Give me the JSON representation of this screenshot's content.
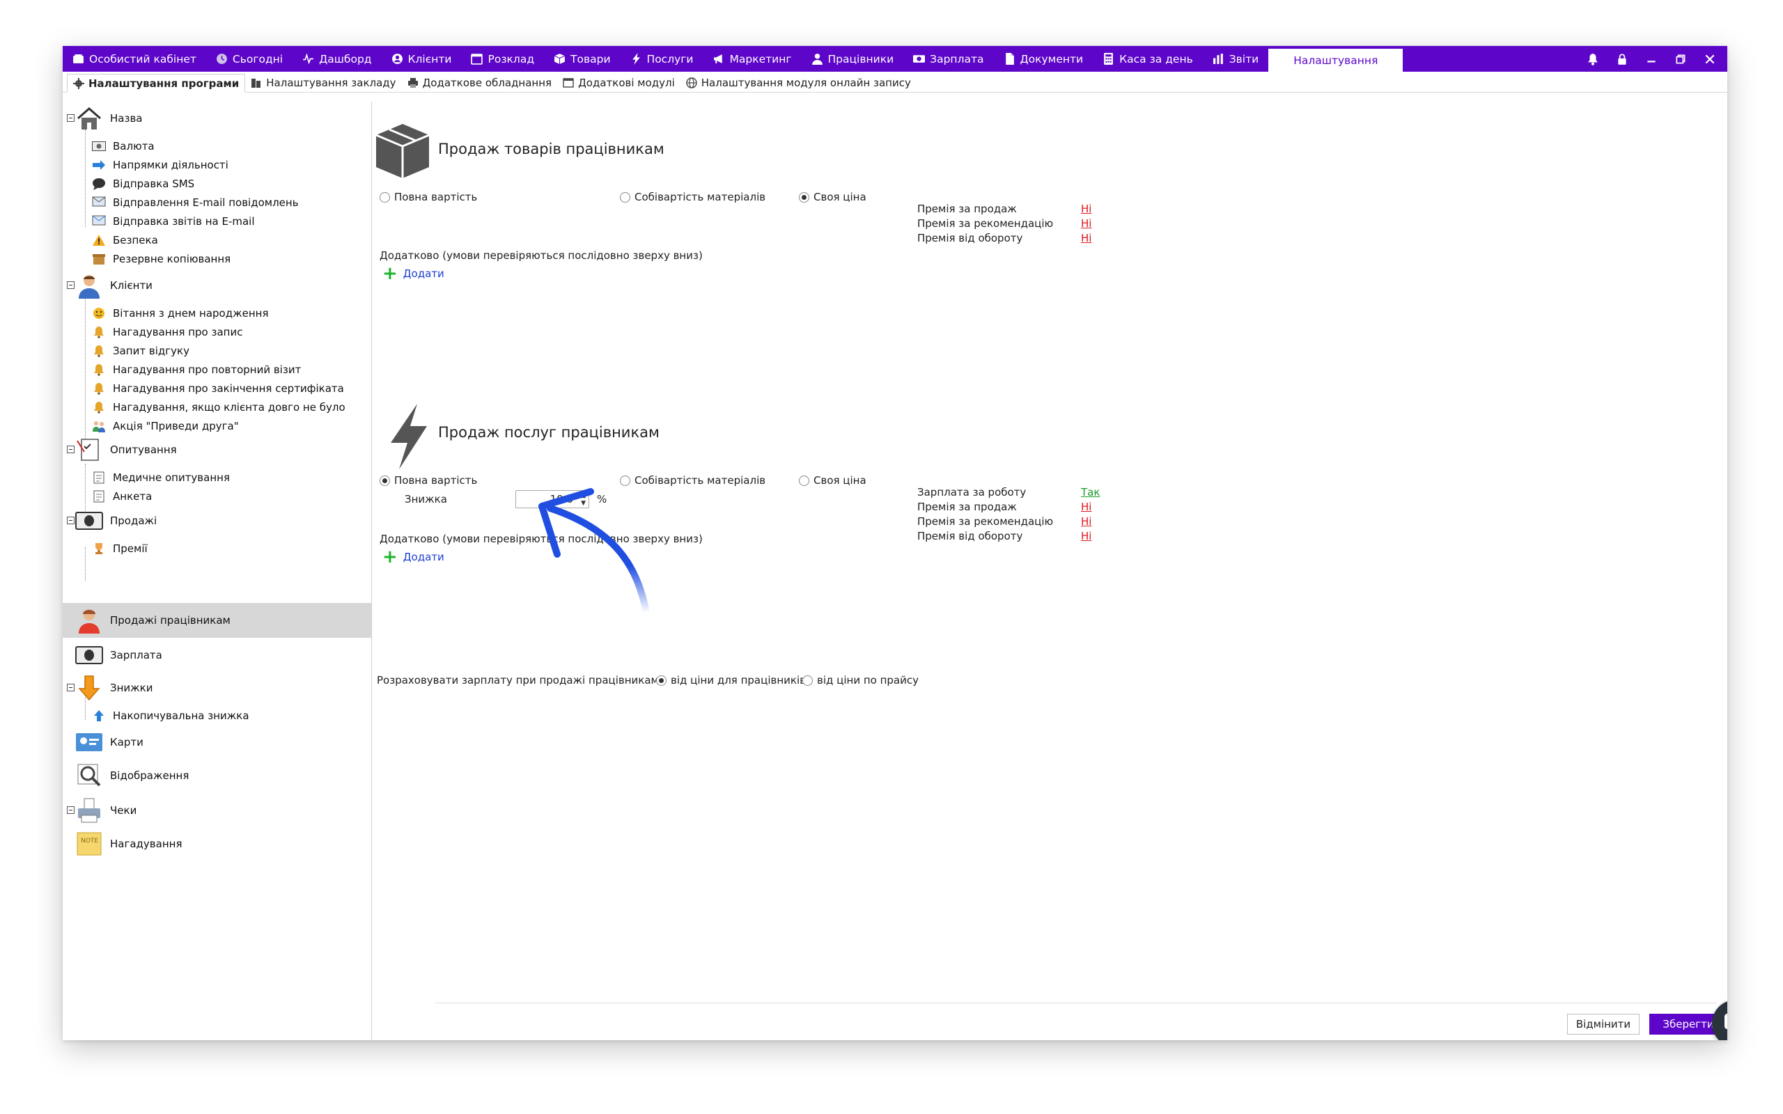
{
  "menu": {
    "items": [
      {
        "label": "Особистий кабінет",
        "icon": "wallet-icon"
      },
      {
        "label": "Сьогодні",
        "icon": "clock-icon"
      },
      {
        "label": "Дашборд",
        "icon": "pulse-icon"
      },
      {
        "label": "Клієнти",
        "icon": "user-circle-icon"
      },
      {
        "label": "Розклад",
        "icon": "calendar-icon"
      },
      {
        "label": "Товари",
        "icon": "box-icon"
      },
      {
        "label": "Послуги",
        "icon": "bolt-icon"
      },
      {
        "label": "Маркетинг",
        "icon": "megaphone-icon"
      },
      {
        "label": "Працівники",
        "icon": "person-icon"
      },
      {
        "label": "Зарплата",
        "icon": "money-icon"
      },
      {
        "label": "Документи",
        "icon": "document-icon"
      },
      {
        "label": "Каса за день",
        "icon": "calculator-icon"
      },
      {
        "label": "Звіти",
        "icon": "bar-chart-icon"
      }
    ],
    "active": "Налаштування"
  },
  "subtabs": [
    {
      "label": "Налаштування програми"
    },
    {
      "label": "Налаштування закладу"
    },
    {
      "label": "Додаткове обладнання"
    },
    {
      "label": "Додаткові модулі"
    },
    {
      "label": "Налаштування модуля онлайн запису"
    }
  ],
  "tree": {
    "name": "Назва",
    "name_children": [
      "Валюта",
      "Напрямки діяльності",
      "Відправка SMS",
      "Відправлення E-mail повідомлень",
      "Відправка звітів на E-mail",
      "Безпека",
      "Резервне копіювання"
    ],
    "clients": "Клієнти",
    "clients_children": [
      "Вітання з днем народження",
      "Нагадування про запис",
      "Запит відгуку",
      "Нагадування про повторний візит",
      "Нагадування про закінчення сертифіката",
      "Нагадування, якщо клієнта довго не було",
      "Акція \"Приведи друга\""
    ],
    "surveys": "Опитування",
    "surveys_children": [
      "Медичне опитування",
      "Анкета"
    ],
    "sales": "Продажі",
    "sales_children": [
      "Премії"
    ],
    "employee_sales": "Продажі працівникам",
    "salary": "Зарплата",
    "discounts": "Знижки",
    "discounts_children": [
      "Накопичувальна знижка"
    ],
    "cards": "Карти",
    "display": "Відображення",
    "receipts": "Чеки",
    "reminders": "Нагадування"
  },
  "goods": {
    "title": "Продаж товарів працівникам",
    "options": [
      "Повна вартість",
      "Собівартість матеріалів",
      "Своя ціна"
    ],
    "selected": 2,
    "bonuses": [
      {
        "label": "Премія за продаж",
        "value": "Ні"
      },
      {
        "label": "Премія за рекомендацію",
        "value": "Ні"
      },
      {
        "label": "Премія від обороту",
        "value": "Ні"
      }
    ],
    "extra": "Додатково (умови перевіряються послідовно зверху вниз)",
    "add": "Додати"
  },
  "services": {
    "title": "Продаж послуг працівникам",
    "options": [
      "Повна вартість",
      "Собівартість матеріалів",
      "Своя ціна"
    ],
    "selected": 0,
    "discount_label": "Знижка",
    "discount_value": "10.0",
    "discount_unit": "%",
    "bonuses": [
      {
        "label": "Зарплата за роботу",
        "value": "Так"
      },
      {
        "label": "Премія за продаж",
        "value": "Ні"
      },
      {
        "label": "Премія за рекомендацію",
        "value": "Ні"
      },
      {
        "label": "Премія від обороту",
        "value": "Ні"
      }
    ],
    "extra": "Додатково (умови перевіряються послідовно зверху вниз)",
    "add": "Додати"
  },
  "salary_calc": {
    "label": "Розраховувати зарплату при продажі працівникам",
    "options": [
      "від ціни для працівників",
      "від ціни по прайсу"
    ],
    "selected": 0
  },
  "buttons": {
    "cancel": "Відмінити",
    "save": "Зберегти"
  },
  "colors": {
    "accent": "#5d05c9",
    "link_no": "#e0161b",
    "link_yes": "#1a9c2a",
    "add_link": "#1a3fd1",
    "annotation_arrow": "#1f4ee0"
  }
}
